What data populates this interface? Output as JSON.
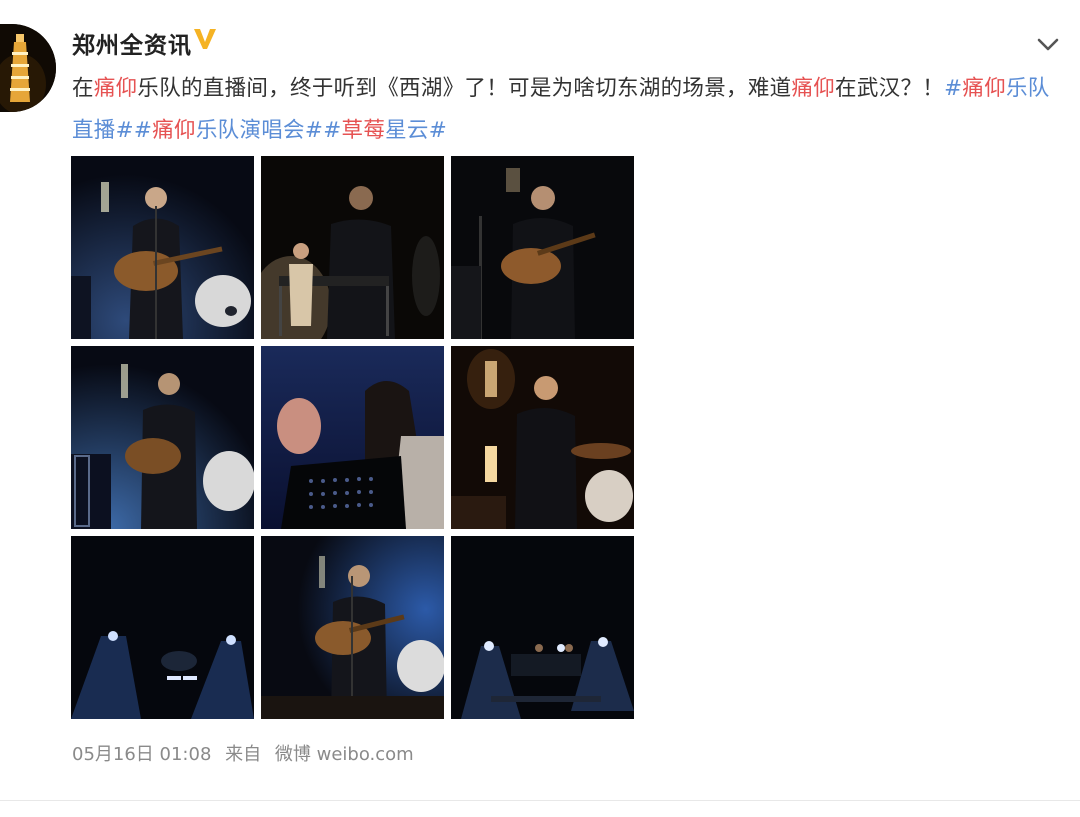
{
  "post": {
    "author": "郑州全资讯",
    "text_parts": [
      {
        "text": "在",
        "style": "plain"
      },
      {
        "text": "痛仰",
        "style": "red"
      },
      {
        "text": "乐队的直播间，终于听到《西湖》了！可是为啥切东湖的场景，难道",
        "style": "plain"
      },
      {
        "text": "痛仰",
        "style": "red"
      },
      {
        "text": "在武汉？！",
        "style": "plain"
      },
      {
        "text": "#",
        "style": "blue"
      },
      {
        "text": "痛仰",
        "style": "red"
      },
      {
        "text": "乐队直播#",
        "style": "blue"
      },
      {
        "text": "#",
        "style": "blue"
      },
      {
        "text": "痛仰",
        "style": "red"
      },
      {
        "text": "乐队演唱会#",
        "style": "blue"
      },
      {
        "text": "#",
        "style": "blue"
      },
      {
        "text": "草莓",
        "style": "red"
      },
      {
        "text": "星云#",
        "style": "blue"
      }
    ],
    "date": "05月16日 01:08",
    "source_prefix": "来自",
    "source_name": "微博 weibo.com"
  },
  "colors": {
    "keyword_red": "#e65252",
    "hashtag_blue": "#5b8dd6",
    "verified_gold": "#f5b324",
    "meta_gray": "#8a8a8a"
  },
  "icons": {
    "verified": "verified-v-icon",
    "more": "chevron-down-icon"
  },
  "photos": [
    {
      "scene": "guitarist-singing-blue-stage"
    },
    {
      "scene": "keyboard-player-backlit"
    },
    {
      "scene": "guitarist-singing-dark"
    },
    {
      "scene": "guitarist-with-drums-blue"
    },
    {
      "scene": "female-singer-music-stand"
    },
    {
      "scene": "singer-drums-warm-lights"
    },
    {
      "scene": "dark-stage-spotlights"
    },
    {
      "scene": "guitarist-singing-wide"
    },
    {
      "scene": "wide-stage-lights"
    }
  ]
}
